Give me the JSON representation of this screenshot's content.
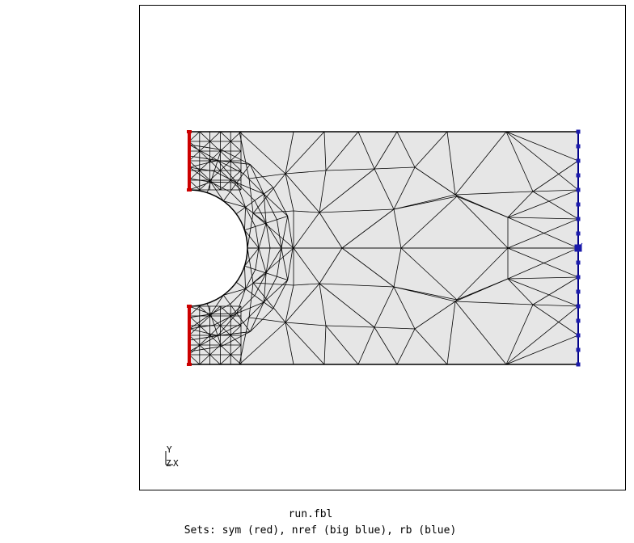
{
  "filename": "run.fbl",
  "sets_caption": "Sets: sym (red), nref (big blue), rb (blue)",
  "triad": {
    "y": "Y",
    "z": "Z",
    "x": "X"
  },
  "colors": {
    "mesh_fill": "#e6e6e6",
    "mesh_edge": "#000000",
    "sym": "#cc0000",
    "nref": "#1a1aaa",
    "rb": "#000088"
  }
}
